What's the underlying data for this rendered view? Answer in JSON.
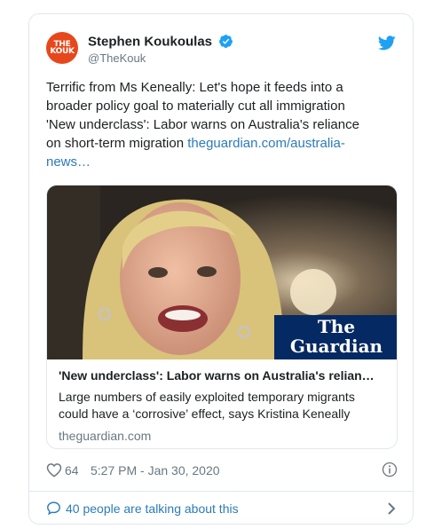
{
  "author": {
    "avatar_text": "THE KOUK",
    "display_name": "Stephen Koukoulas",
    "handle": "@TheKouk",
    "verified": true
  },
  "tweet": {
    "text": "Terrific from Ms Keneally: Let's hope it feeds into a broader policy goal to materially cut all immigration 'New underclass': Labor warns on Australia's reliance on short-term migration ",
    "link_text": "theguardian.com/australia-news…"
  },
  "link_card": {
    "logo_line1": "The",
    "logo_line2": "Guardian",
    "title": "'New underclass': Labor warns on Australia's relian…",
    "description": "Large numbers of easily exploited temporary migrants could have a ‘corrosive’ effect, says Kristina Keneally",
    "domain": "theguardian.com"
  },
  "meta": {
    "likes": "64",
    "timestamp": "5:27 PM - Jan 30, 2020"
  },
  "footer": {
    "talking": "40 people are talking about this"
  },
  "colors": {
    "link": "#2b7bb9",
    "twitter_blue": "#1da1f2",
    "guardian_blue": "#052962",
    "muted": "#697882"
  },
  "icons": [
    "verified-badge-icon",
    "twitter-bird-icon",
    "heart-icon",
    "info-icon",
    "reply-bubble-icon",
    "chevron-right-icon"
  ]
}
